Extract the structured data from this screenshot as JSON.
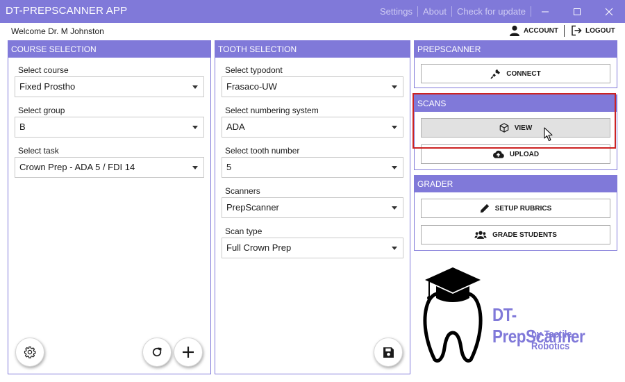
{
  "app": {
    "title": "DT-PREPSCANNER APP"
  },
  "top_links": [
    {
      "label": "Settings"
    },
    {
      "label": "About"
    },
    {
      "label": "Check for update"
    }
  ],
  "window_controls": {
    "minimize": "minimize-icon",
    "maximize": "maximize-icon",
    "close": "close-icon"
  },
  "user": {
    "welcome": "Welcome Dr. M Johnston",
    "account_label": "ACCOUNT",
    "logout_label": "LOGOUT"
  },
  "course_selection": {
    "header": "COURSE SELECTION",
    "fields": [
      {
        "label": "Select course",
        "value": "Fixed Prostho"
      },
      {
        "label": "Select group",
        "value": "B"
      },
      {
        "label": "Select task",
        "value": "Crown Prep - ADA 5 / FDI 14"
      }
    ]
  },
  "tooth_selection": {
    "header": "TOOTH SELECTION",
    "fields": [
      {
        "label": "Select typodont",
        "value": "Frasaco-UW"
      },
      {
        "label": "Select numbering system",
        "value": "ADA"
      },
      {
        "label": "Select tooth number",
        "value": "5"
      },
      {
        "label": "Scanners",
        "value": "PrepScanner"
      },
      {
        "label": "Scan type",
        "value": "Full Crown Prep"
      }
    ]
  },
  "prepscanner": {
    "header": "PREPSCANNER",
    "connect_label": "CONNECT"
  },
  "scans": {
    "header": "SCANS",
    "view_label": "VIEW",
    "upload_label": "UPLOAD"
  },
  "grader": {
    "header": "GRADER",
    "setup_rubrics_label": "SETUP RUBRICS",
    "grade_students_label": "GRADE STUDENTS"
  },
  "logo": {
    "name": "DT-PrepScanner",
    "byline": "by Tactile Robotics"
  },
  "colors": {
    "accent": "#8079d9",
    "highlight": "#cc2222"
  }
}
